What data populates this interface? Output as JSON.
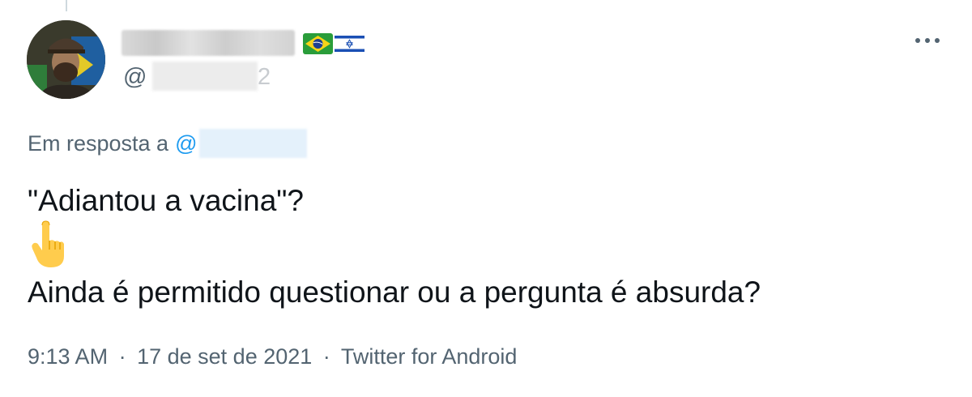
{
  "tweet": {
    "handle_prefix": "@",
    "handle_suffix": "2",
    "reply_label": "Em resposta a",
    "reply_at": "@",
    "lines": [
      "\"Adiantou a vacina\"?",
      "Ainda é permitido questionar ou a pergunta é absurda?"
    ],
    "time": "9:13 AM",
    "separator": "·",
    "date": "17 de set de 2021",
    "source": "Twitter for Android",
    "flags": [
      "brazil-flag",
      "israel-flag"
    ],
    "emoji": "backhand-index-pointing-up"
  },
  "colors": {
    "text": "#0f1419",
    "secondary": "#536471",
    "link": "#1d9bf0",
    "emoji": "#ffcc4d"
  }
}
